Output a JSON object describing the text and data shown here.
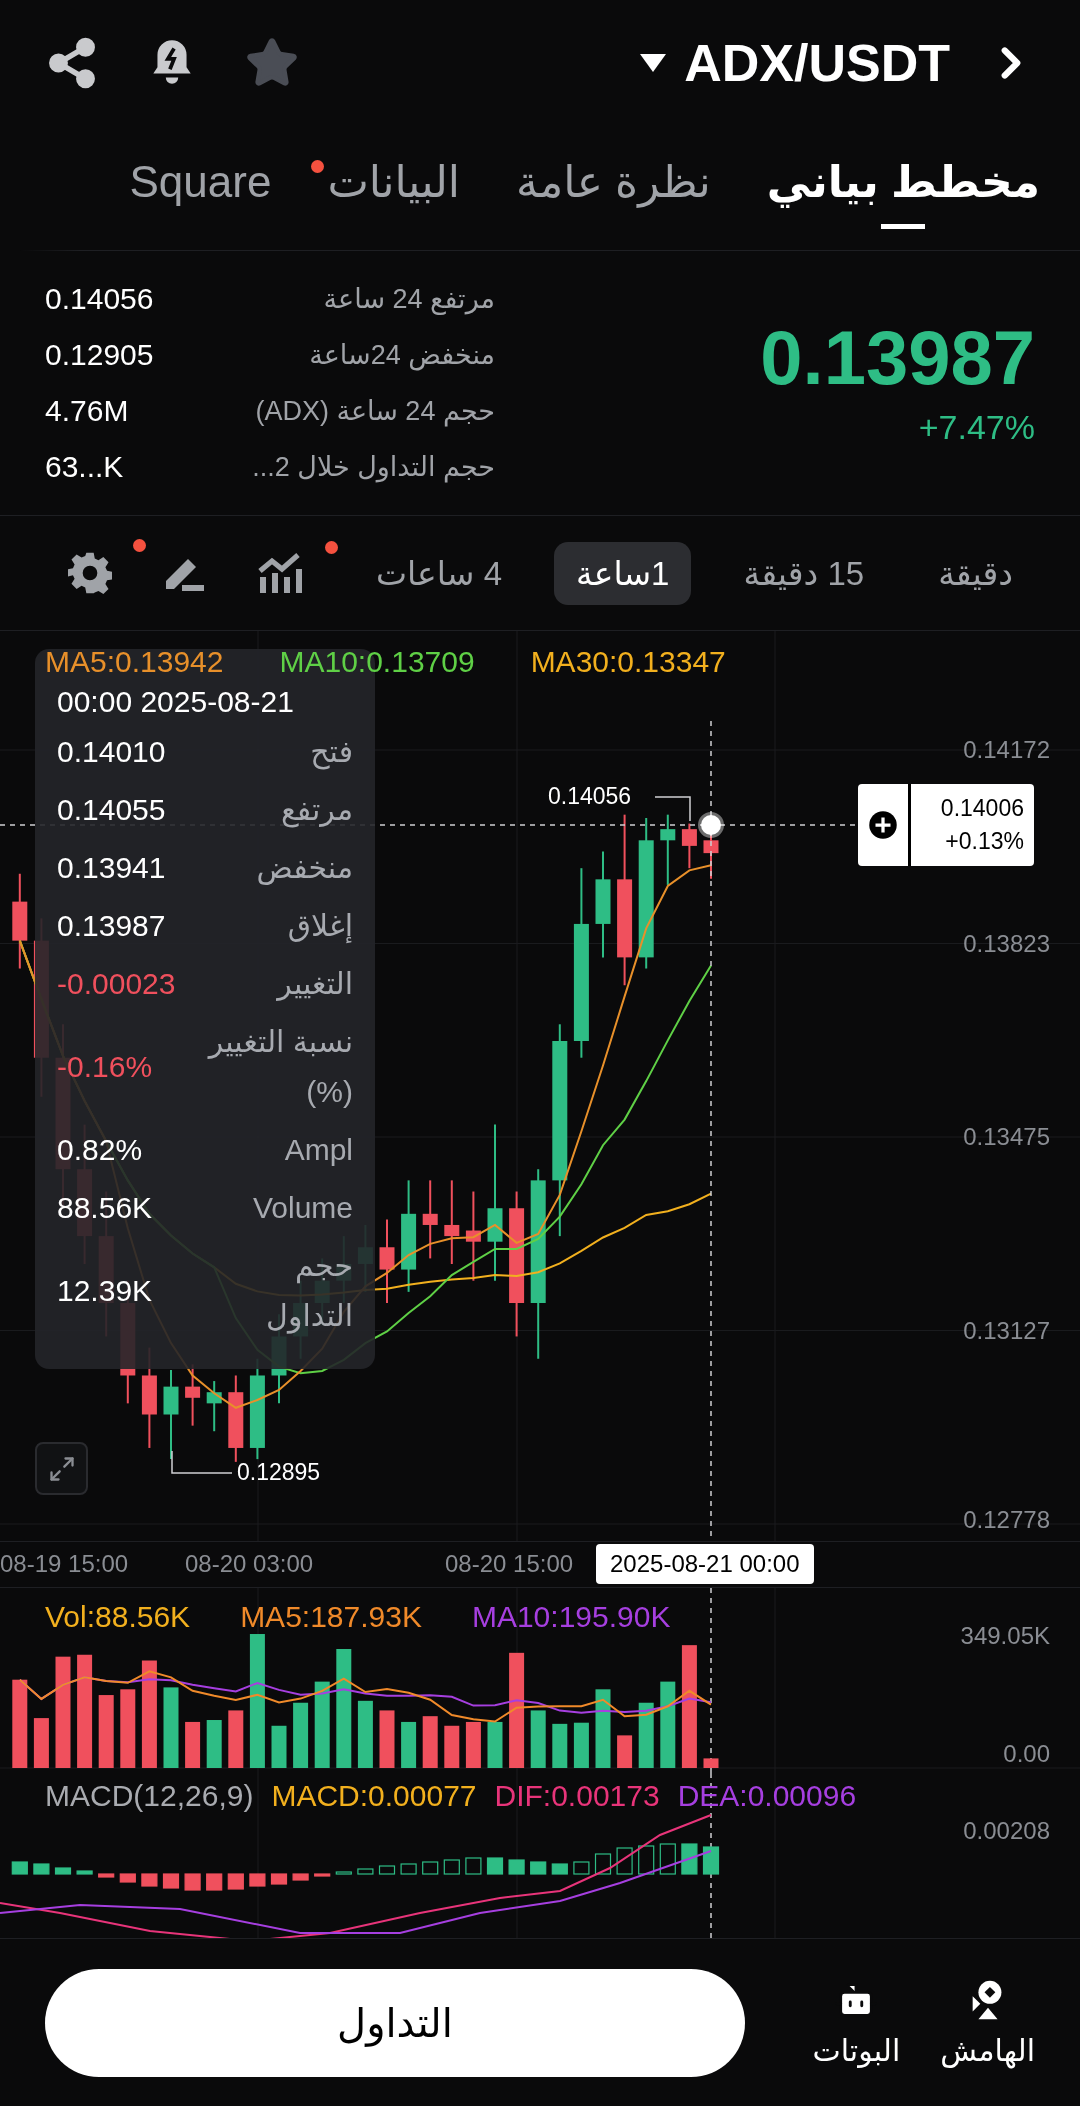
{
  "header": {
    "pair": "ADX/USDT"
  },
  "tabs": [
    {
      "label": "مخطط بياني",
      "selected": true,
      "dot": false
    },
    {
      "label": "نظرة عامة",
      "selected": false,
      "dot": false
    },
    {
      "label": "البيانات",
      "selected": false,
      "dot": true
    },
    {
      "label": "Square",
      "selected": false,
      "dot": false
    }
  ],
  "ticker": {
    "price": "0.13987",
    "change": "+7.47%",
    "stats": [
      {
        "label": "مرتفع 24 ساعة",
        "value": "0.14056"
      },
      {
        "label": "منخفض 24ساعة",
        "value": "0.12905"
      },
      {
        "label": "حجم 24 ساعة (ADX)",
        "value": "4.76M"
      },
      {
        "label": "حجم التداول خلال 2...",
        "value": "63...K"
      }
    ]
  },
  "intervals": [
    {
      "label": "دقيقة",
      "selected": false
    },
    {
      "label": "15 دقيقة",
      "selected": false
    },
    {
      "label": "1ساعة",
      "selected": true
    },
    {
      "label": "4 ساعات",
      "selected": false
    }
  ],
  "tools": [
    {
      "kind": "indicators",
      "dot": true
    },
    {
      "kind": "draw",
      "dot": false
    },
    {
      "kind": "settings",
      "dot": true
    }
  ],
  "chart": {
    "ma_labels": [
      {
        "text": "MA30:0.13347",
        "color": "#f2b01e"
      },
      {
        "text": "MA10:0.13709",
        "color": "#5fd046"
      },
      {
        "text": "MA5:0.13942",
        "color": "#e8902a"
      }
    ],
    "price_ticks": [
      "0.14172",
      "0.13823",
      "0.13475",
      "0.13127",
      "0.12778"
    ],
    "high_mark": "0.14056",
    "low_mark": "0.12895",
    "cursor_price": "0.14006",
    "cursor_change": "+0.13%",
    "time_ticks": [
      "08-20 15:00",
      "08-20 03:00",
      "08-19 15:00"
    ],
    "cursor_time": "2025-08-21 00:00",
    "tooltip": {
      "time": "00:00 2025-08-21",
      "rows": [
        {
          "label": "فتح",
          "value": "0.14010",
          "color": "#ffffff"
        },
        {
          "label": "مرتفع",
          "value": "0.14055",
          "color": "#ffffff"
        },
        {
          "label": "منخفض",
          "value": "0.13941",
          "color": "#ffffff"
        },
        {
          "label": "إغلاق",
          "value": "0.13987",
          "color": "#ffffff"
        },
        {
          "label": "التغيير",
          "value": "-0.00023",
          "color": "#f0505d"
        },
        {
          "label": "نسبة التغيير (%)",
          "value": "-0.16%",
          "color": "#f0505d"
        },
        {
          "label": "Ampl",
          "value": "0.82%",
          "color": "#ffffff"
        },
        {
          "label": "Volume",
          "value": "88.56K",
          "color": "#ffffff"
        },
        {
          "label": "حجم التداول",
          "value": "12.39K",
          "color": "#ffffff"
        }
      ]
    }
  },
  "volume": {
    "labels": [
      {
        "text": "MA10:195.90K",
        "color": "#a63fe0"
      },
      {
        "text": "MA5:187.93K",
        "color": "#f08a2a"
      },
      {
        "text": "Vol:88.56K",
        "color": "#f2b01e"
      }
    ],
    "ticks": [
      "349.05K",
      "0.00"
    ]
  },
  "macd": {
    "labels": [
      {
        "text": "DEA:0.00096",
        "color": "#a63fe0"
      },
      {
        "text": "DIF:0.00173",
        "color": "#e8347a"
      },
      {
        "text": "MACD:0.00077",
        "color": "#f2b01e"
      },
      {
        "text": "MACD(12,26,9)",
        "color": "#a9abb0"
      }
    ],
    "ticks": [
      "0.00208"
    ]
  },
  "bottom": {
    "actions": [
      {
        "kind": "margin",
        "label": "الهامش"
      },
      {
        "kind": "bots",
        "label": "البوتات"
      }
    ],
    "trade": "التداول"
  }
}
